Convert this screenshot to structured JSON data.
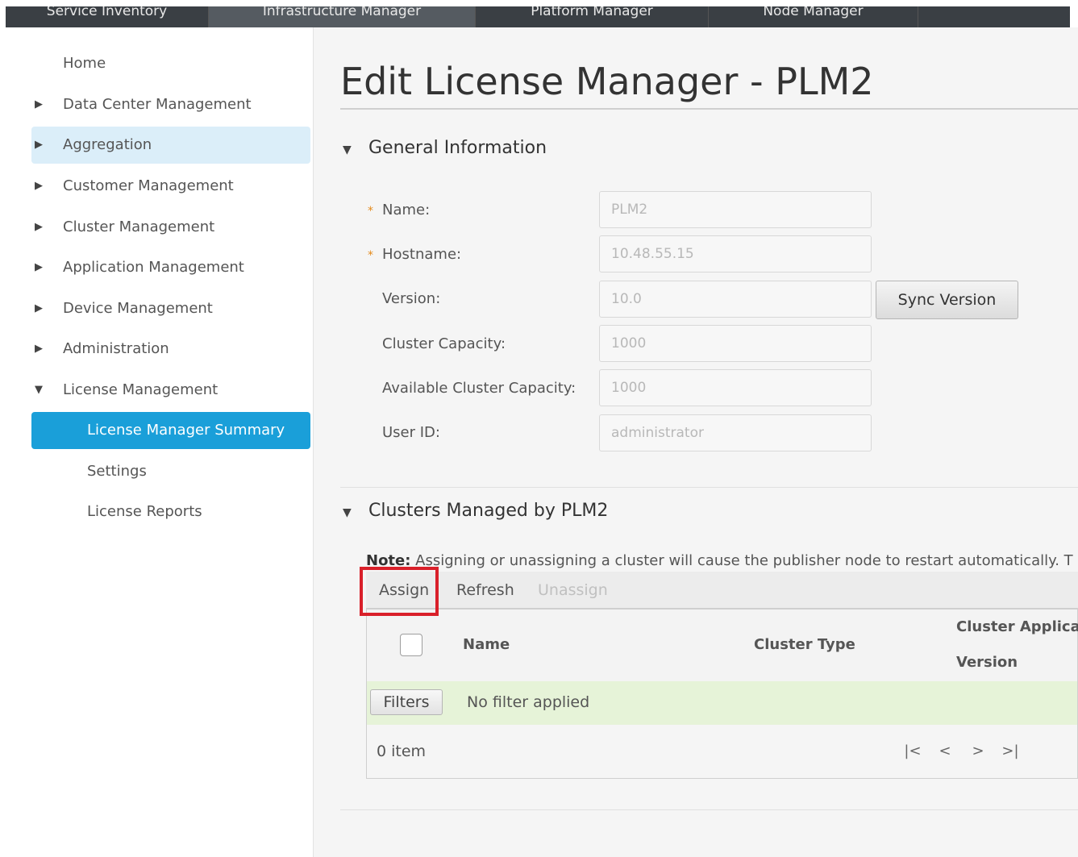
{
  "topnav": {
    "tabs": [
      {
        "label": "Service Inventory"
      },
      {
        "label": "Infrastructure Manager"
      },
      {
        "label": "Platform Manager"
      },
      {
        "label": "Node Manager"
      }
    ]
  },
  "sidebar": {
    "items": [
      {
        "label": "Home"
      },
      {
        "label": "Data Center Management"
      },
      {
        "label": "Aggregation"
      },
      {
        "label": "Customer Management"
      },
      {
        "label": "Cluster Management"
      },
      {
        "label": "Application Management"
      },
      {
        "label": "Device Management"
      },
      {
        "label": "Administration"
      },
      {
        "label": "License Management"
      },
      {
        "label": "License Manager Summary"
      },
      {
        "label": "Settings"
      },
      {
        "label": "License Reports"
      }
    ]
  },
  "page": {
    "title": "Edit License Manager - PLM2"
  },
  "general": {
    "heading": "General Information",
    "required_mark": "*",
    "fields": {
      "name": {
        "label": "Name:",
        "value": "PLM2"
      },
      "hostname": {
        "label": "Hostname:",
        "value": "10.48.55.15"
      },
      "version": {
        "label": "Version:",
        "value": "10.0"
      },
      "cluster_capacity": {
        "label": "Cluster Capacity:",
        "value": "1000"
      },
      "available_capacity": {
        "label": "Available Cluster Capacity:",
        "value": "1000"
      },
      "user_id": {
        "label": "User ID:",
        "value": "administrator"
      }
    },
    "sync_label": "Sync Version"
  },
  "clusters": {
    "heading": "Clusters Managed by PLM2",
    "note_bold": "Note:",
    "note_text": " Assigning or unassigning a cluster will cause the publisher node to restart automatically. T",
    "toolbar": {
      "assign": "Assign",
      "refresh": "Refresh",
      "unassign": "Unassign"
    },
    "columns": {
      "name": "Name",
      "type": "Cluster Type",
      "app_line1": "Cluster Applicat",
      "app_line2": "Version"
    },
    "filters_label": "Filters",
    "filter_status": "No filter applied",
    "item_count": "0 item",
    "pager": {
      "first": "|<",
      "prev": "<",
      "next": ">",
      "last": ">|"
    }
  },
  "colors": {
    "accent": "#1a9fd9",
    "highlight": "#d9202a",
    "required": "#e48a1b"
  }
}
